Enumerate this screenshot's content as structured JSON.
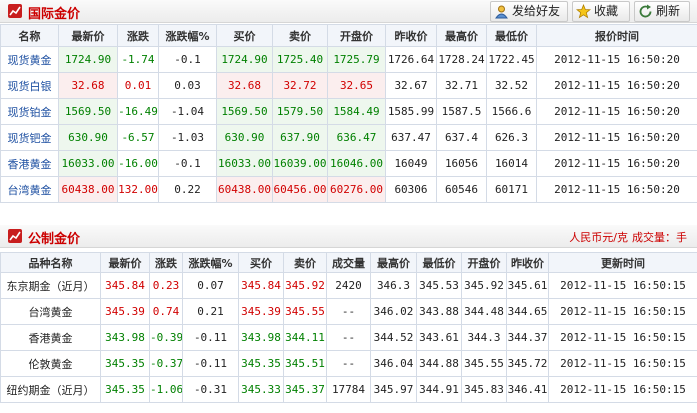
{
  "intl": {
    "title": "国际金价",
    "buttons": {
      "share": "发给好友",
      "fav": "收藏",
      "refresh": "刷新"
    },
    "headers": [
      "名称",
      "最新价",
      "涨跌",
      "涨跌幅%",
      "买价",
      "卖价",
      "开盘价",
      "昨收价",
      "最高价",
      "最低价",
      "报价时间"
    ],
    "rows": [
      {
        "name": "现货黄金",
        "latest": "1724.90",
        "chg": "-1.74",
        "pct": "-0.1",
        "bid": "1724.90",
        "ask": "1725.40",
        "open": "1725.79",
        "prev": "1726.64",
        "high": "1728.24",
        "low": "1722.45",
        "time": "2012-11-15  16:50:20",
        "dir": "dn"
      },
      {
        "name": "现货白银",
        "latest": "32.68",
        "chg": "0.01",
        "pct": "0.03",
        "bid": "32.68",
        "ask": "32.72",
        "open": "32.65",
        "prev": "32.67",
        "high": "32.71",
        "low": "32.52",
        "time": "2012-11-15  16:50:20",
        "dir": "up"
      },
      {
        "name": "现货铂金",
        "latest": "1569.50",
        "chg": "-16.49",
        "pct": "-1.04",
        "bid": "1569.50",
        "ask": "1579.50",
        "open": "1584.49",
        "prev": "1585.99",
        "high": "1587.5",
        "low": "1566.6",
        "time": "2012-11-15  16:50:20",
        "dir": "dn"
      },
      {
        "name": "现货钯金",
        "latest": "630.90",
        "chg": "-6.57",
        "pct": "-1.03",
        "bid": "630.90",
        "ask": "637.90",
        "open": "636.47",
        "prev": "637.47",
        "high": "637.4",
        "low": "626.3",
        "time": "2012-11-15  16:50:20",
        "dir": "dn"
      },
      {
        "name": "香港黄金",
        "latest": "16033.00",
        "chg": "-16.00",
        "pct": "-0.1",
        "bid": "16033.00",
        "ask": "16039.00",
        "open": "16046.00",
        "prev": "16049",
        "high": "16056",
        "low": "16014",
        "time": "2012-11-15  16:50:20",
        "dir": "dn"
      },
      {
        "name": "台湾黄金",
        "latest": "60438.00",
        "chg": "132.00",
        "pct": "0.22",
        "bid": "60438.00",
        "ask": "60456.00",
        "open": "60276.00",
        "prev": "60306",
        "high": "60546",
        "low": "60171",
        "time": "2012-11-15  16:50:20",
        "dir": "up"
      }
    ]
  },
  "public": {
    "title": "公制金价",
    "unit": "人民币元/克",
    "volume_label": "成交量：",
    "volume_unit": "手",
    "headers": [
      "品种名称",
      "最新价",
      "涨跌",
      "涨跌幅%",
      "买价",
      "卖价",
      "成交量",
      "最高价",
      "最低价",
      "开盘价",
      "昨收价",
      "更新时间"
    ],
    "rows": [
      {
        "name": "东京期金（近月）",
        "latest": "345.84",
        "chg": "0.23",
        "pct": "0.07",
        "bid": "345.84",
        "ask": "345.92",
        "vol": "2420",
        "high": "346.3",
        "low": "345.53",
        "open": "345.92",
        "prev": "345.61",
        "time": "2012-11-15  16:50:15",
        "dir": "up"
      },
      {
        "name": "台湾黄金",
        "latest": "345.39",
        "chg": "0.74",
        "pct": "0.21",
        "bid": "345.39",
        "ask": "345.55",
        "vol": "--",
        "high": "346.02",
        "low": "343.88",
        "open": "344.48",
        "prev": "344.65",
        "time": "2012-11-15  16:50:15",
        "dir": "up"
      },
      {
        "name": "香港黄金",
        "latest": "343.98",
        "chg": "-0.39",
        "pct": "-0.11",
        "bid": "343.98",
        "ask": "344.11",
        "vol": "--",
        "high": "344.52",
        "low": "343.61",
        "open": "344.3",
        "prev": "344.37",
        "time": "2012-11-15  16:50:15",
        "dir": "dn"
      },
      {
        "name": "伦敦黄金",
        "latest": "345.35",
        "chg": "-0.37",
        "pct": "-0.11",
        "bid": "345.35",
        "ask": "345.51",
        "vol": "--",
        "high": "346.04",
        "low": "344.88",
        "open": "345.55",
        "prev": "345.72",
        "time": "2012-11-15  16:50:15",
        "dir": "dn"
      },
      {
        "name": "纽约期金（近月）",
        "latest": "345.35",
        "chg": "-1.06",
        "pct": "-0.31",
        "bid": "345.33",
        "ask": "345.37",
        "vol": "17784",
        "high": "345.97",
        "low": "344.91",
        "open": "345.83",
        "prev": "346.41",
        "time": "2012-11-15  16:50:15",
        "dir": "dn"
      }
    ]
  },
  "colors": {
    "up": "#d10000",
    "down": "#008000",
    "accent": "#c81e1e"
  }
}
